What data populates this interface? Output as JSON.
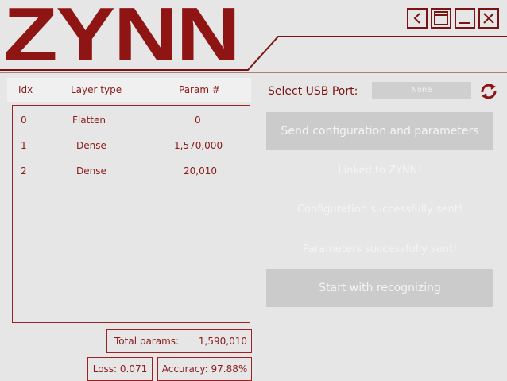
{
  "app": {
    "logo_text": "ZYNN"
  },
  "window_controls": [
    {
      "name": "back-icon"
    },
    {
      "name": "maximize-icon"
    },
    {
      "name": "minimize-icon"
    },
    {
      "name": "close-icon"
    }
  ],
  "table": {
    "headers": [
      "Idx",
      "Layer type",
      "Param #"
    ],
    "rows": [
      {
        "idx": "0",
        "type": "Flatten",
        "params": "0"
      },
      {
        "idx": "1",
        "type": "Dense",
        "params": "1,570,000"
      },
      {
        "idx": "2",
        "type": "Dense",
        "params": "20,010"
      }
    ]
  },
  "stats": {
    "total_label": "Total params:",
    "total_value": "1,590,010",
    "loss": "Loss: 0.071",
    "accuracy": "Accuracy: 97.88%"
  },
  "usb": {
    "label": "Select USB Port:",
    "selected": "None",
    "refresh_icon": "refresh-icon"
  },
  "actions": {
    "send_label": "Send configuration and parameters",
    "start_label": "Start with recognizing"
  },
  "status": {
    "linked": "Linked to ZYNN!",
    "config_sent": "Configuration successfully sent!",
    "params_sent": "Parameters successfully sent!"
  },
  "colors": {
    "accent": "#8f1515",
    "background": "#e6e6e6",
    "disabled": "#cbcbcb"
  }
}
